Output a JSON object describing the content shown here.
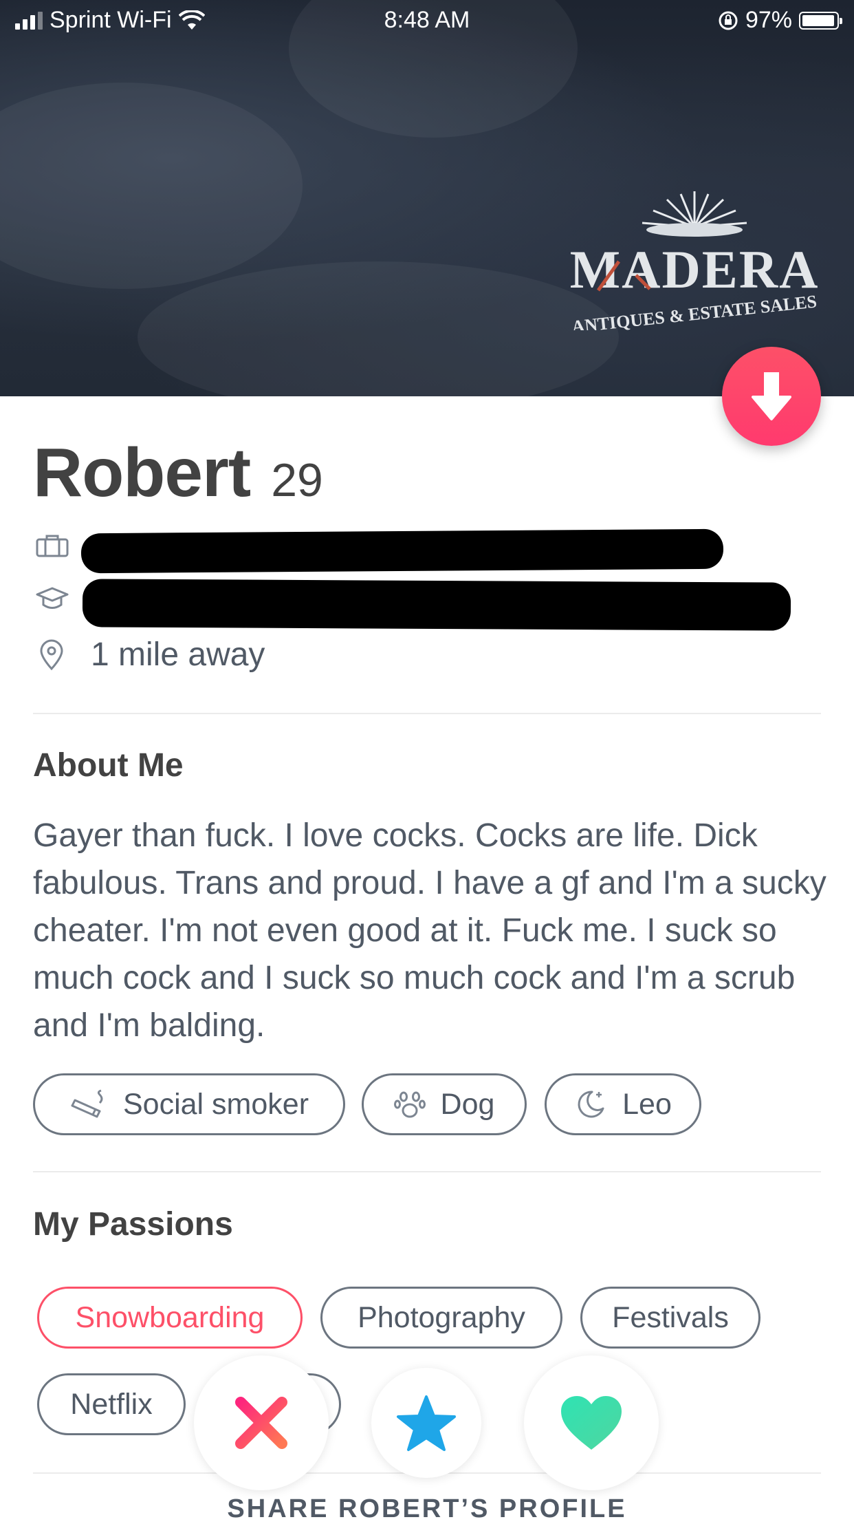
{
  "status_bar": {
    "carrier": "Sprint Wi-Fi",
    "time": "8:48 AM",
    "battery": "97%",
    "wifi_icon": "wifi-icon",
    "lock_icon": "orientation-lock-icon"
  },
  "photo": {
    "logo_text": "MADERA",
    "logo_subtitle": "ANTIQUES & ESTATE SALES"
  },
  "profile": {
    "name": "Robert",
    "age": "29",
    "job_icon": "briefcase-icon",
    "school_icon": "graduation-cap-icon",
    "location_icon": "location-pin-icon",
    "distance": "1 mile away"
  },
  "about": {
    "title": "About Me",
    "bio": "Gayer than fuck. I love cocks. Cocks are life. Dick fabulous. Trans and proud. I have a gf and I'm a sucky cheater. I'm not even good at it. Fuck me. I suck so much cock and I suck so much cock and I'm a scrub and I'm balding.",
    "lifestyle": [
      {
        "icon": "cigarette-icon",
        "label": "Social smoker"
      },
      {
        "icon": "paw-icon",
        "label": "Dog"
      },
      {
        "icon": "moon-icon",
        "label": "Leo"
      }
    ]
  },
  "passions": {
    "title": "My Passions",
    "items": [
      "Snowboarding",
      "Photography",
      "Festivals",
      "Netflix"
    ],
    "highlighted": "Snowboarding"
  },
  "actions": {
    "nope_icon": "close-icon",
    "superlike_icon": "star-icon",
    "like_icon": "heart-icon"
  },
  "share_label": "SHARE ROBERT’S PROFILE",
  "colors": {
    "accent": "#fd5068",
    "superlike": "#1fa6e8",
    "like": "#37d6a6"
  }
}
